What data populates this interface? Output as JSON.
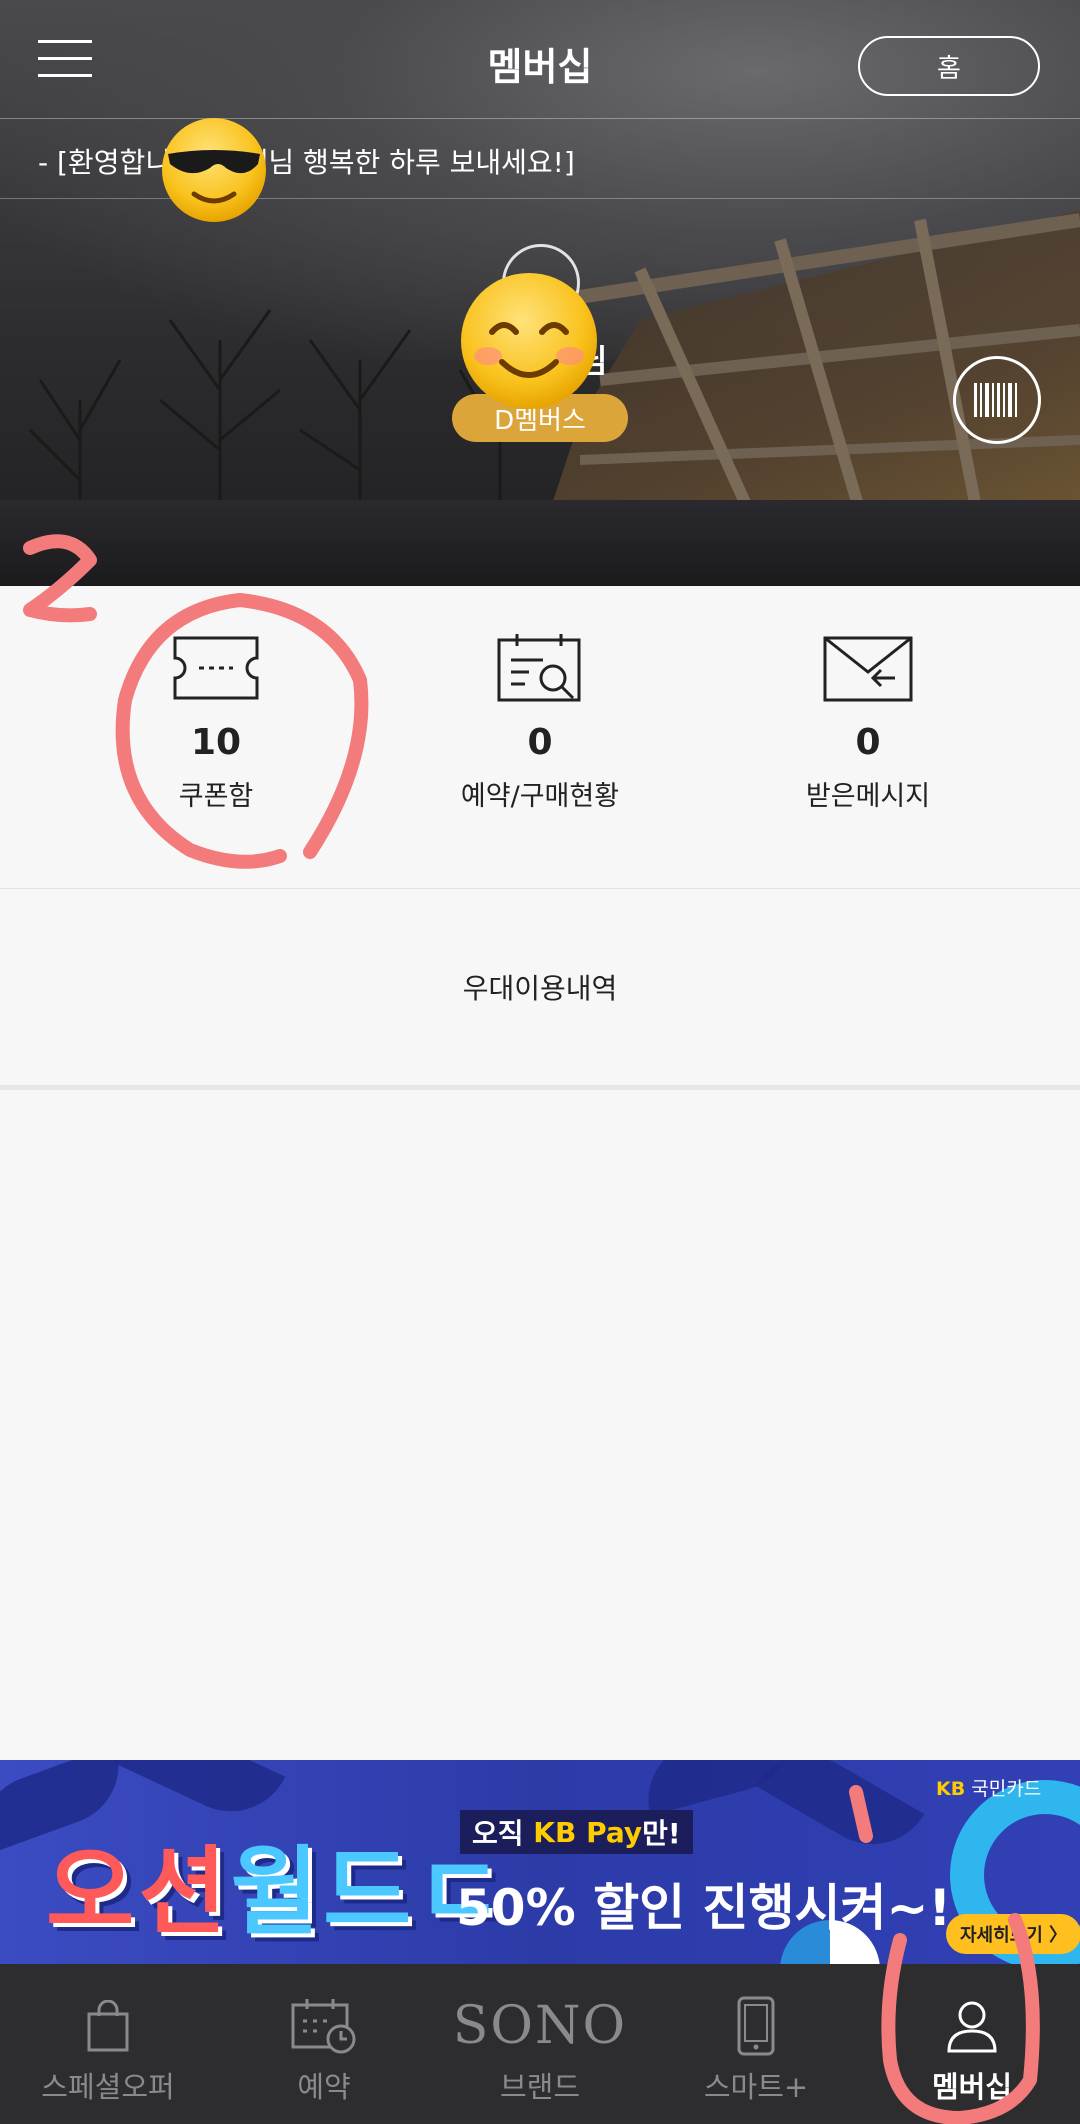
{
  "header": {
    "title": "멤버십",
    "home_label": "홈"
  },
  "welcome": {
    "text": "- [환영합니다! 고객님 행복한 하루 보내세요!]"
  },
  "member": {
    "name_tail": "님",
    "grade": "D멤버스"
  },
  "stats": [
    {
      "count": "10",
      "label": "쿠폰함",
      "icon": "ticket-icon"
    },
    {
      "count": "0",
      "label": "예약/구매현황",
      "icon": "calendar-search-icon"
    },
    {
      "count": "0",
      "label": "받은메시지",
      "icon": "envelope-icon"
    }
  ],
  "benefit": {
    "label": "우대이용내역"
  },
  "banner": {
    "title_a": "오션",
    "title_b": "월드",
    "title_c": "ㄷ",
    "tag_prefix": "오직 ",
    "tag_kb": "KB Pay",
    "tag_suffix": "만!",
    "subtitle": "50% 할인 진행시켜~!",
    "card_mark": "KB",
    "card_name": "국민카드",
    "detail": "자세히보기 〉"
  },
  "bottom_nav": [
    {
      "label": "스페셜오퍼",
      "icon": "shopping-bag-icon"
    },
    {
      "label": "예약",
      "icon": "calendar-clock-icon"
    },
    {
      "label": "브랜드",
      "icon": "sono-logo",
      "logo_text": "SONO"
    },
    {
      "label": "스마트+",
      "icon": "smartphone-icon"
    },
    {
      "label": "멤버십",
      "icon": "person-icon",
      "active": true
    }
  ],
  "colors": {
    "grade_badge": "#dba53a",
    "annotation": "#f37b7b",
    "nav_bg": "#2d2d2f",
    "banner_bg": "#2c3ba8"
  }
}
